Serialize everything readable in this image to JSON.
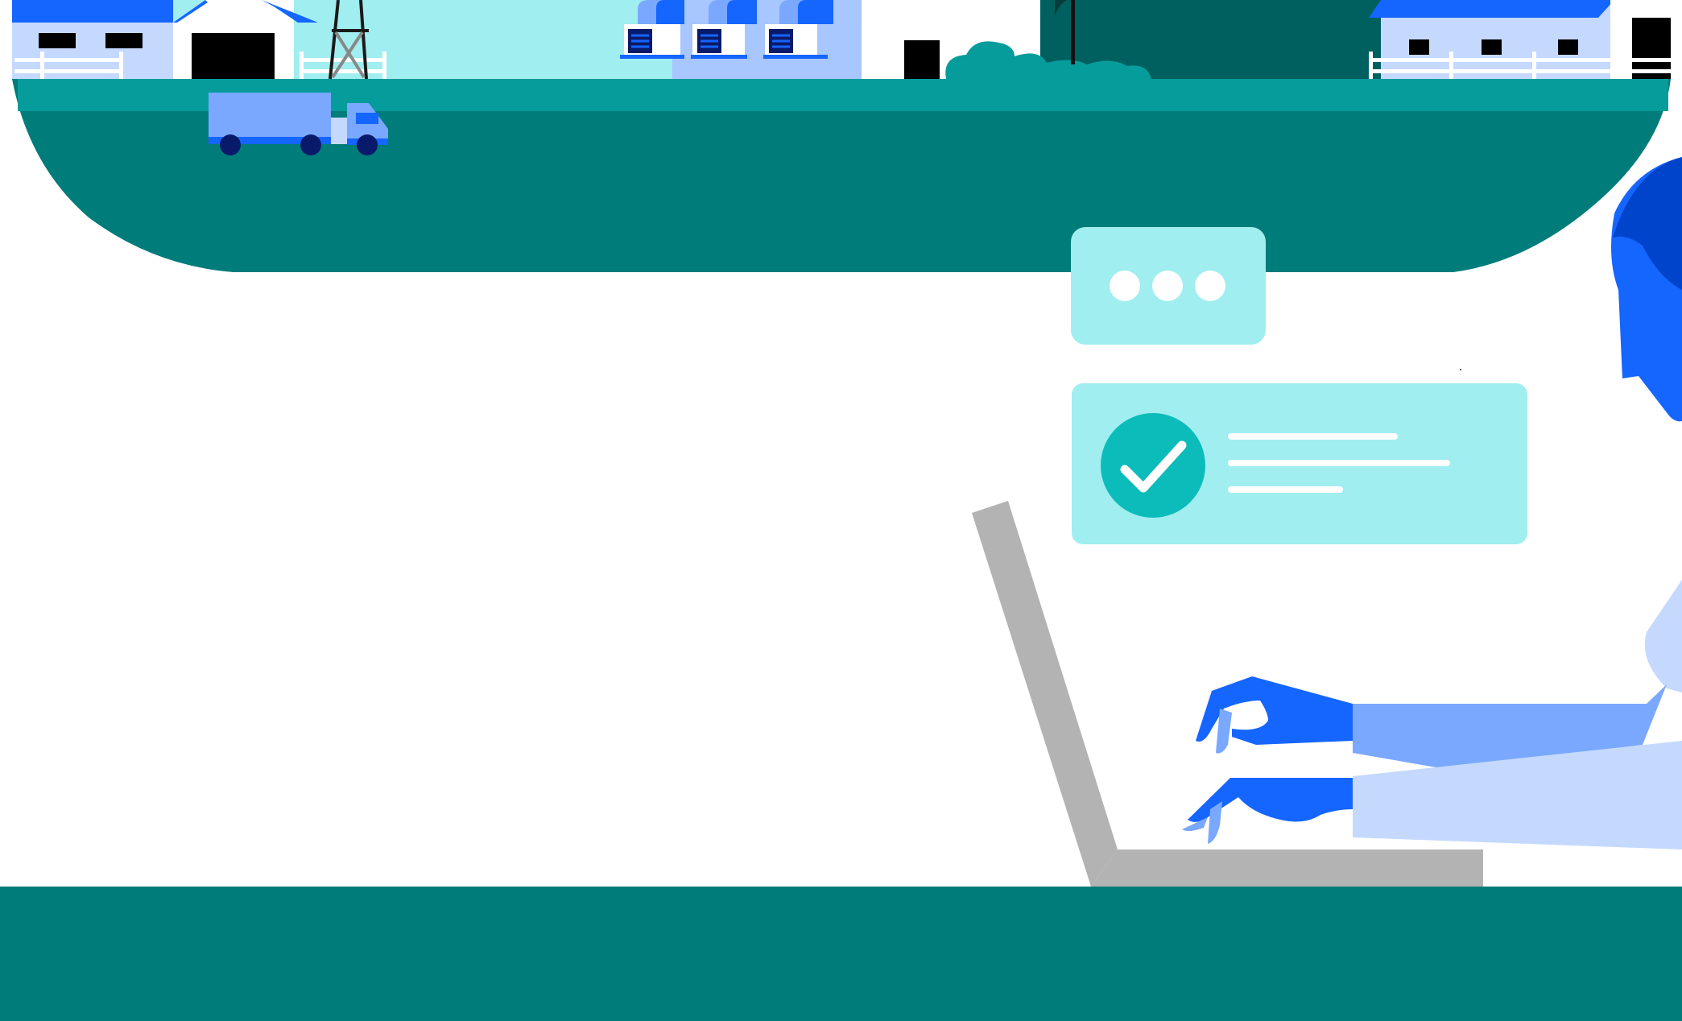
{
  "colors": {
    "teal_dark": "#007c7a",
    "teal_mid": "#069c9b",
    "sky": "#a0eeef",
    "blue": "#1565ff",
    "blue_light": "#7aa8ff",
    "blue_pale": "#c5d9ff",
    "navy": "#0a1a6b",
    "gray": "#b3b3b3",
    "check_teal": "#0cbcba",
    "tree_dark": "#006060"
  },
  "icons": {
    "chat_bubble": "ellipsis-chat-icon",
    "confirmation": "checkmark-icon"
  },
  "footer": {
    "text": "",
    "logo": ""
  }
}
